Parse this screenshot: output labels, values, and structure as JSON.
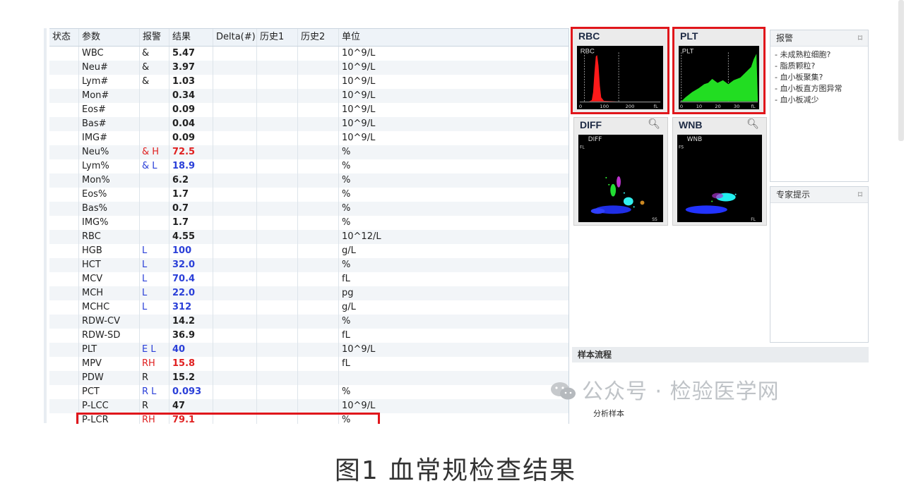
{
  "table": {
    "headers": [
      "状态",
      "参数",
      "报警",
      "结果",
      "Delta(#)",
      "历史1",
      "历史2",
      "单位"
    ],
    "rows": [
      {
        "param": "WBC",
        "flag": "&",
        "result": "5.47",
        "unit": "10^9/L"
      },
      {
        "param": "Neu#",
        "flag": "&",
        "result": "3.97",
        "unit": "10^9/L"
      },
      {
        "param": "Lym#",
        "flag": "&",
        "result": "1.03",
        "unit": "10^9/L"
      },
      {
        "param": "Mon#",
        "flag": "",
        "result": "0.34",
        "unit": "10^9/L"
      },
      {
        "param": "Eos#",
        "flag": "",
        "result": "0.09",
        "unit": "10^9/L"
      },
      {
        "param": "Bas#",
        "flag": "",
        "result": "0.04",
        "unit": "10^9/L"
      },
      {
        "param": "IMG#",
        "flag": "",
        "result": "0.09",
        "unit": "10^9/L"
      },
      {
        "param": "Neu%",
        "flag": "& H",
        "result": "72.5",
        "unit": "%"
      },
      {
        "param": "Lym%",
        "flag": "& L",
        "result": "18.9",
        "unit": "%"
      },
      {
        "param": "Mon%",
        "flag": "",
        "result": "6.2",
        "unit": "%"
      },
      {
        "param": "Eos%",
        "flag": "",
        "result": "1.7",
        "unit": "%"
      },
      {
        "param": "Bas%",
        "flag": "",
        "result": "0.7",
        "unit": "%"
      },
      {
        "param": "IMG%",
        "flag": "",
        "result": "1.7",
        "unit": "%"
      },
      {
        "param": "RBC",
        "flag": "",
        "result": "4.55",
        "unit": "10^12/L"
      },
      {
        "param": "HGB",
        "flag": "L",
        "result": "100",
        "unit": "g/L"
      },
      {
        "param": "HCT",
        "flag": "L",
        "result": "32.0",
        "unit": "%"
      },
      {
        "param": "MCV",
        "flag": "L",
        "result": "70.4",
        "unit": "fL"
      },
      {
        "param": "MCH",
        "flag": "L",
        "result": "22.0",
        "unit": "pg"
      },
      {
        "param": "MCHC",
        "flag": "L",
        "result": "312",
        "unit": "g/L"
      },
      {
        "param": "RDW-CV",
        "flag": "",
        "result": "14.2",
        "unit": "%"
      },
      {
        "param": "RDW-SD",
        "flag": "",
        "result": "36.9",
        "unit": "fL"
      },
      {
        "param": "PLT",
        "flag": "E L",
        "result": "40",
        "unit": "10^9/L"
      },
      {
        "param": "MPV",
        "flag": "RH",
        "result": "15.8",
        "unit": "fL"
      },
      {
        "param": "PDW",
        "flag": "R",
        "result": "15.2",
        "unit": ""
      },
      {
        "param": "PCT",
        "flag": "R L",
        "result": "0.093",
        "unit": "%"
      },
      {
        "param": "P-LCC",
        "flag": "R",
        "result": "47",
        "unit": "10^9/L"
      },
      {
        "param": "P-LCR",
        "flag": "RH",
        "result": "79.1",
        "unit": "%"
      }
    ]
  },
  "histograms": {
    "rbc": {
      "title": "RBC",
      "label": "RBC",
      "ticks": [
        "0",
        "100",
        "200",
        "fL"
      ]
    },
    "plt": {
      "title": "PLT",
      "label": "PLT",
      "ticks": [
        "0",
        "10",
        "20",
        "30",
        "fL"
      ]
    },
    "diff": {
      "title": "DIFF",
      "label": "DIFF",
      "yaxis": "FL",
      "xaxis": "SS"
    },
    "wnb": {
      "title": "WNB",
      "label": "WNB",
      "yaxis": "FS",
      "xaxis": "FL"
    }
  },
  "alarm_panel": {
    "title": "报警",
    "expand_icon": "⌑",
    "items": [
      "- 未成熟粒细胞?",
      "- 脂质颗粒?",
      "- 血小板聚集?",
      "- 血小板直方图异常",
      "- 血小板减少"
    ]
  },
  "expert_panel": {
    "title": "专家提示",
    "expand_icon": "⌑"
  },
  "flow_panel": {
    "title": "样本流程",
    "label": "分析样本"
  },
  "watermark": "公众号 · 检验医学网",
  "caption": "图1 血常规检查结果",
  "colors": {
    "alarm_red": "#e0161b",
    "high": "#e02020",
    "low": "#2a3fd8"
  }
}
